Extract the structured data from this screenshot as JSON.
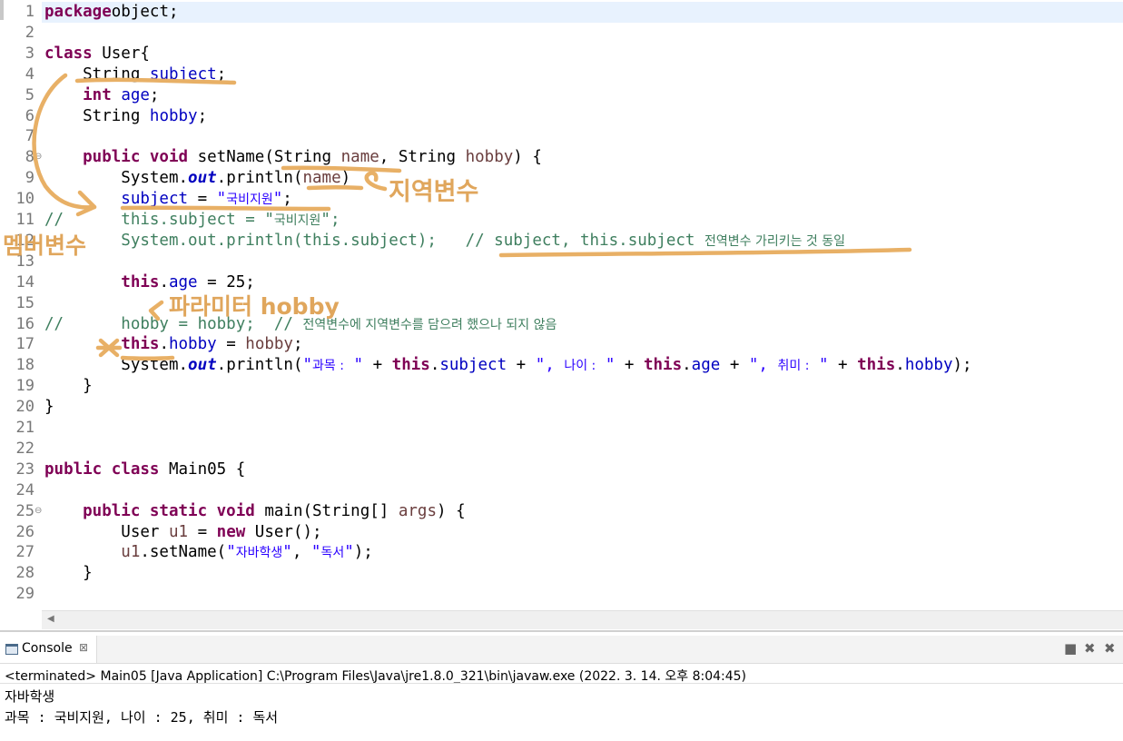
{
  "editor": {
    "lines": [
      {
        "n": "1",
        "t": [
          [
            "kw",
            "package"
          ],
          [
            "",
            "object;"
          ]
        ]
      },
      {
        "n": "2",
        "t": []
      },
      {
        "n": "3",
        "t": [
          [
            "kw",
            "class"
          ],
          [
            "",
            " User{"
          ]
        ]
      },
      {
        "n": "4",
        "t": [
          [
            "",
            "    String "
          ],
          [
            "fld",
            "subject"
          ],
          [
            "",
            ";"
          ]
        ]
      },
      {
        "n": "5",
        "t": [
          [
            "kw",
            "    int"
          ],
          [
            "",
            " "
          ],
          [
            "fld",
            "age"
          ],
          [
            "",
            ";"
          ]
        ]
      },
      {
        "n": "6",
        "t": [
          [
            "",
            "    String "
          ],
          [
            "fld",
            "hobby"
          ],
          [
            "",
            ";"
          ]
        ]
      },
      {
        "n": "7",
        "t": []
      },
      {
        "n": "8",
        "t": [
          [
            "kw",
            "    public void"
          ],
          [
            "",
            " setName(String "
          ],
          [
            "prm",
            "name"
          ],
          [
            "",
            ", String "
          ],
          [
            "prm",
            "hobby"
          ],
          [
            "",
            ") {"
          ]
        ]
      },
      {
        "n": "9",
        "t": [
          [
            "",
            "        System."
          ],
          [
            "st",
            "out"
          ],
          [
            "",
            ".println("
          ],
          [
            "prm",
            "name"
          ],
          [
            "",
            ")"
          ]
        ]
      },
      {
        "n": "10",
        "t": [
          [
            "fld",
            "        subject"
          ],
          [
            "",
            " = "
          ],
          [
            "str",
            "\""
          ],
          [
            "strs",
            "국비지원"
          ],
          [
            "str",
            "\""
          ],
          [
            "",
            ";"
          ]
        ]
      },
      {
        "n": "11",
        "t": [
          [
            "cm",
            "//      this.subject = \""
          ],
          [
            "cms",
            "국비지원"
          ],
          [
            "cm",
            "\";"
          ]
        ]
      },
      {
        "n": "12",
        "t": [
          [
            "cm",
            "        System.out.println(this.subject);   // subject, this.subject "
          ],
          [
            "cms",
            "전역변수 가리키는 것 동일"
          ]
        ]
      },
      {
        "n": "13",
        "t": []
      },
      {
        "n": "14",
        "t": [
          [
            "kw",
            "        this"
          ],
          [
            "",
            "."
          ],
          [
            "fld",
            "age"
          ],
          [
            "",
            " = 25;"
          ]
        ]
      },
      {
        "n": "15",
        "t": []
      },
      {
        "n": "16",
        "t": [
          [
            "cm",
            "//      hobby = hobby;  // "
          ],
          [
            "cms",
            "전역변수에 지역변수를 담으려 했으나 되지 않음"
          ]
        ]
      },
      {
        "n": "17",
        "t": [
          [
            "kw",
            "        this"
          ],
          [
            "",
            "."
          ],
          [
            "fld",
            "hobby"
          ],
          [
            "",
            " = "
          ],
          [
            "prm",
            "hobby"
          ],
          [
            "",
            ";"
          ]
        ]
      },
      {
        "n": "18",
        "t": [
          [
            "",
            "        System."
          ],
          [
            "st",
            "out"
          ],
          [
            "",
            ".println("
          ],
          [
            "str",
            "\""
          ],
          [
            "strs",
            "과목 :"
          ],
          [
            "str",
            " \""
          ],
          [
            "",
            " + "
          ],
          [
            "kw",
            "this"
          ],
          [
            "",
            "."
          ],
          [
            "fld",
            "subject"
          ],
          [
            "",
            " + "
          ],
          [
            "str",
            "\", "
          ],
          [
            "strs",
            "나이 :"
          ],
          [
            "str",
            " \""
          ],
          [
            "",
            " + "
          ],
          [
            "kw",
            "this"
          ],
          [
            "",
            "."
          ],
          [
            "fld",
            "age"
          ],
          [
            "",
            " + "
          ],
          [
            "str",
            "\", "
          ],
          [
            "strs",
            "취미 :"
          ],
          [
            "str",
            " \""
          ],
          [
            "",
            " + "
          ],
          [
            "kw",
            "this"
          ],
          [
            "",
            "."
          ],
          [
            "fld",
            "hobby"
          ],
          [
            "",
            ");"
          ]
        ]
      },
      {
        "n": "19",
        "t": [
          [
            "",
            "    }"
          ]
        ]
      },
      {
        "n": "20",
        "t": [
          [
            "",
            "}"
          ]
        ]
      },
      {
        "n": "21",
        "t": []
      },
      {
        "n": "22",
        "t": []
      },
      {
        "n": "23",
        "t": [
          [
            "kw",
            "public class"
          ],
          [
            "",
            " Main05 {"
          ]
        ]
      },
      {
        "n": "24",
        "t": []
      },
      {
        "n": "25",
        "t": [
          [
            "kw",
            "    public static void"
          ],
          [
            "",
            " main(String[] "
          ],
          [
            "prm",
            "args"
          ],
          [
            "",
            ") {"
          ]
        ]
      },
      {
        "n": "26",
        "t": [
          [
            "",
            "        User "
          ],
          [
            "prm",
            "u1"
          ],
          [
            "",
            " = "
          ],
          [
            "kw",
            "new"
          ],
          [
            "",
            " User();"
          ]
        ]
      },
      {
        "n": "27",
        "t": [
          [
            "prm",
            "        u1"
          ],
          [
            "",
            ".setName("
          ],
          [
            "str",
            "\""
          ],
          [
            "strs",
            "자바학생"
          ],
          [
            "str",
            "\""
          ],
          [
            "",
            ", "
          ],
          [
            "str",
            "\""
          ],
          [
            "strs",
            "독서"
          ],
          [
            "str",
            "\""
          ],
          [
            "",
            ");"
          ]
        ]
      },
      {
        "n": "28",
        "t": [
          [
            "",
            "    }"
          ]
        ]
      },
      {
        "n": "29",
        "t": []
      }
    ]
  },
  "annotations": {
    "local_var": "지역변수",
    "member_var": "멤버변수",
    "param": "파라미터 hobby"
  },
  "console": {
    "tab_label": "Console",
    "status": "<terminated> Main05 [Java Application] C:\\Program Files\\Java\\jre1.8.0_321\\bin\\javaw.exe (2022. 3. 14. 오후 8:04:45)",
    "output": [
      "자바학생",
      "과목 : 국비지원, 나이 : 25, 취미 : 독서"
    ]
  }
}
